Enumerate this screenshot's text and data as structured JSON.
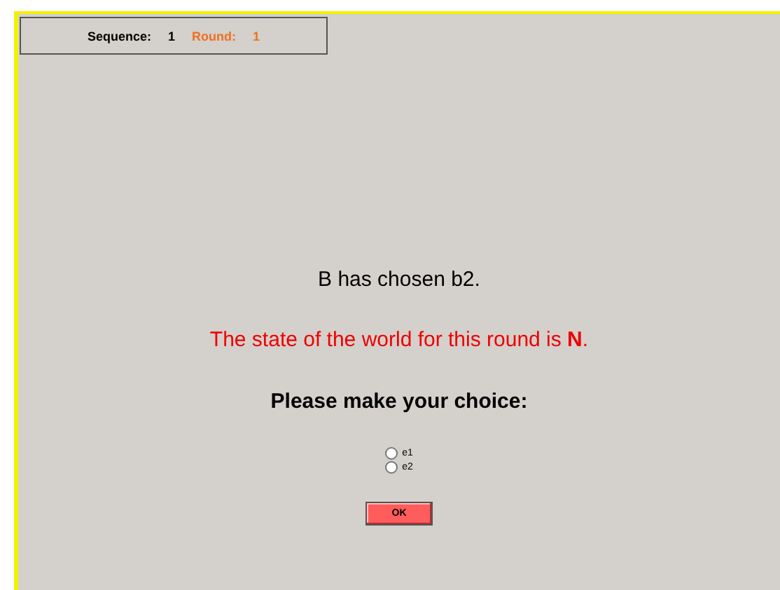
{
  "header": {
    "sequence_label": "Sequence:",
    "sequence": "1",
    "round_label": "Round:",
    "round": "1"
  },
  "message": "B has chosen b2.",
  "state_message": "The state of the world for this round is **N**.",
  "prompt": "Please make your choice:",
  "options": [
    {
      "label": "e1",
      "selected": false
    },
    {
      "label": "e2",
      "selected": false
    }
  ],
  "button": "OK"
}
